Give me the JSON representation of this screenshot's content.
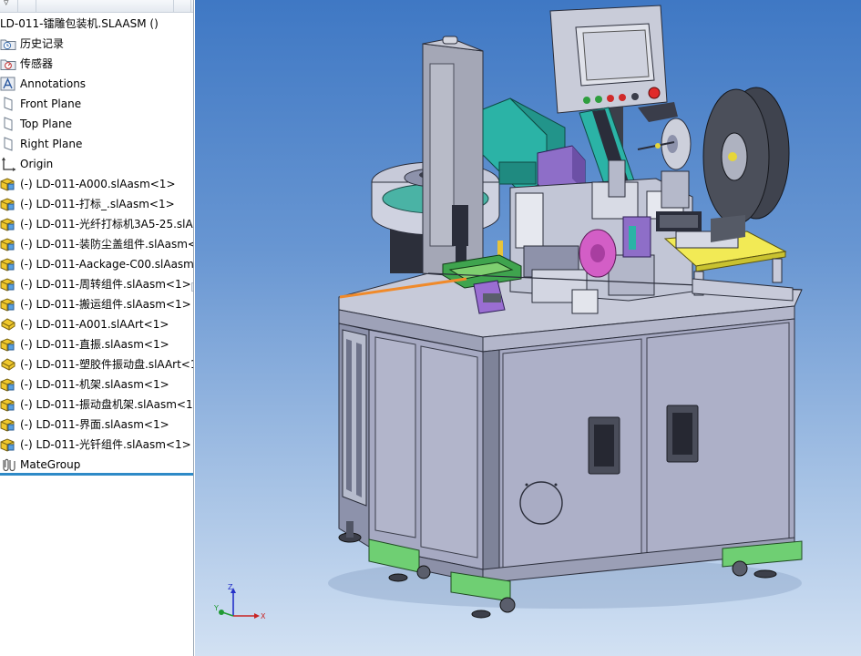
{
  "feature_tree": {
    "root": {
      "label": "LD-011-镭雕包装机.SLAASM  ()",
      "icon": "assembly-icon"
    },
    "items": [
      {
        "label": "历史记录",
        "icon": "history-folder-icon"
      },
      {
        "label": "传感器",
        "icon": "sensor-folder-icon"
      },
      {
        "label": "Annotations",
        "icon": "annotations-icon"
      },
      {
        "label": "Front Plane",
        "icon": "plane-icon"
      },
      {
        "label": "Top Plane",
        "icon": "plane-icon"
      },
      {
        "label": "Right Plane",
        "icon": "plane-icon"
      },
      {
        "label": "Origin",
        "icon": "origin-icon"
      },
      {
        "label": "(-) LD-011-A000.slAasm<1>",
        "icon": "subassembly-icon"
      },
      {
        "label": "(-) LD-011-打标_.slAasm<1>",
        "icon": "subassembly-icon"
      },
      {
        "label": "(-) LD-011-光纤打标机3A5-25.slAa",
        "icon": "subassembly-icon"
      },
      {
        "label": "(-) LD-011-装防尘盖组件.slAasm<1",
        "icon": "subassembly-icon"
      },
      {
        "label": "(-) LD-011-Aackage-C00.slAasm<",
        "icon": "subassembly-icon"
      },
      {
        "label": "(-) LD-011-周转组件.slAasm<1>",
        "icon": "subassembly-icon"
      },
      {
        "label": "(-) LD-011-搬运组件.slAasm<1>",
        "icon": "subassembly-icon"
      },
      {
        "label": "(-) LD-011-A001.slAArt<1>",
        "icon": "part-icon"
      },
      {
        "label": "(-) LD-011-直振.slAasm<1>",
        "icon": "subassembly-icon"
      },
      {
        "label": "(-) LD-011-塑胶件振动盘.slAArt<1",
        "icon": "part-icon"
      },
      {
        "label": "(-) LD-011-机架.slAasm<1>",
        "icon": "subassembly-icon"
      },
      {
        "label": "(-) LD-011-振动盘机架.slAasm<1>",
        "icon": "subassembly-icon"
      },
      {
        "label": "(-) LD-011-界面.slAasm<1>",
        "icon": "subassembly-icon"
      },
      {
        "label": "(-) LD-011-光钎组件.slAasm<1>",
        "icon": "subassembly-icon"
      },
      {
        "label": "MateGroup",
        "icon": "mate-group-icon"
      }
    ]
  },
  "triad": {
    "x_label": "X",
    "y_label": "Y",
    "z_label": "Z"
  },
  "colors": {
    "viewport_top": "#3f78c4",
    "viewport_bottom": "#d2e1f3",
    "frame_grey": "#9aa0b8",
    "door_grey": "#a6a9c2",
    "foot_green": "#6fcf73",
    "reel_dark": "#4b4f5a",
    "teal_motor": "#2bb3a6",
    "purple_block": "#8e6ec8",
    "magenta_disc": "#d35ec6",
    "yellow_plate": "#f2ea55",
    "laser_line": "#f08a2a",
    "selection_blue": "#2e8ac7"
  }
}
